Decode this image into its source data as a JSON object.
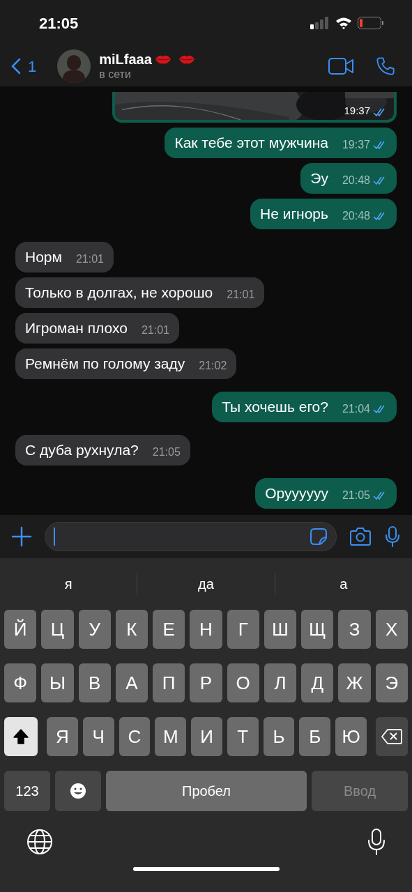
{
  "status_bar": {
    "time": "21:05"
  },
  "header": {
    "back_count": "1",
    "contact_name": "miLfaaa",
    "status": "в сети"
  },
  "messages": [
    {
      "outgoing": true,
      "time": "19:37",
      "read": true
    },
    {
      "kind": "text",
      "outgoing": true,
      "text": "Как тебе этот мужчина",
      "time": "19:37",
      "read": true
    },
    {
      "kind": "text",
      "outgoing": true,
      "text": "Эу",
      "time": "20:48",
      "read": true
    },
    {
      "kind": "text",
      "outgoing": true,
      "text": "Не игнорь",
      "time": "20:48",
      "read": true
    },
    {
      "kind": "text",
      "outgoing": false,
      "text": "Норм",
      "time": "21:01"
    },
    {
      "kind": "text",
      "outgoing": false,
      "text": "Только в долгах, не хорошо",
      "time": "21:01"
    },
    {
      "kind": "text",
      "outgoing": false,
      "text": "Игроман плохо",
      "time": "21:01"
    },
    {
      "kind": "text",
      "outgoing": false,
      "text": "Ремнём по голому заду",
      "time": "21:02"
    },
    {
      "kind": "text",
      "outgoing": true,
      "text": "Ты хочешь его?",
      "time": "21:04",
      "read": true
    },
    {
      "kind": "text",
      "outgoing": false,
      "text": "С дуба рухнула?",
      "time": "21:05"
    },
    {
      "kind": "text",
      "outgoing": true,
      "text": "Оруууууу",
      "time": "21:05",
      "read": true
    }
  ],
  "keyboard": {
    "suggestions": [
      "я",
      "да",
      "а"
    ],
    "top_row": [
      "Й",
      "Ц",
      "У",
      "К",
      "Е",
      "Н",
      "Г",
      "Ш",
      "Щ",
      "З",
      "Х"
    ],
    "middle_row": [
      "Ф",
      "Ы",
      "В",
      "А",
      "П",
      "Р",
      "О",
      "Л",
      "Д",
      "Ж",
      "Э"
    ],
    "bottom_row": [
      "Я",
      "Ч",
      "С",
      "М",
      "И",
      "Т",
      "Ь",
      "Б",
      "Ю"
    ],
    "shift_on": true,
    "number_key": "123",
    "space_key": "Пробел",
    "return_key": {
      "label": "Ввод",
      "disabled": true
    }
  }
}
